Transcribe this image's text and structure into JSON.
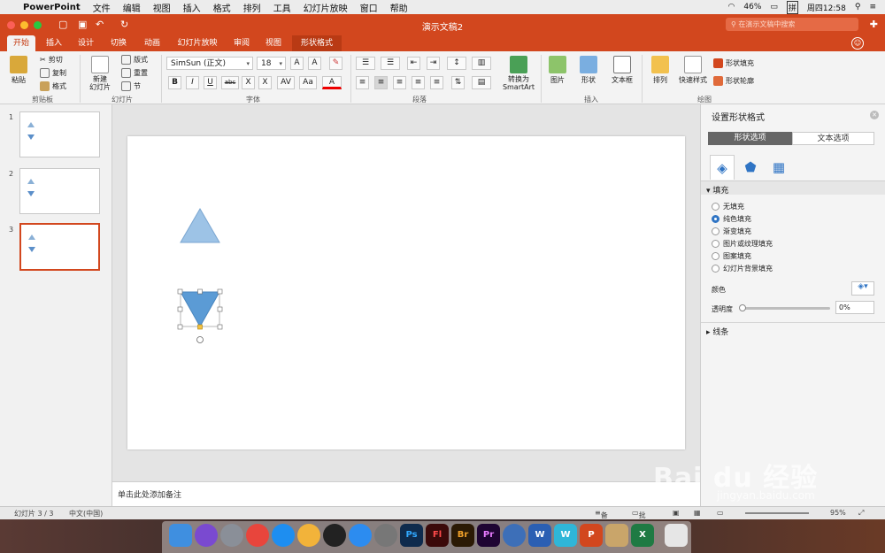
{
  "menubar": {
    "app": "PowerPoint",
    "items": [
      "文件",
      "编辑",
      "视图",
      "插入",
      "格式",
      "排列",
      "工具",
      "幻灯片放映",
      "窗口",
      "帮助"
    ],
    "battery": "46%",
    "ime": "拼",
    "clock": "周四12:58"
  },
  "window": {
    "title": "演示文稿2",
    "search_placeholder": "在演示文稿中搜索"
  },
  "tabs": [
    "开始",
    "插入",
    "设计",
    "切换",
    "动画",
    "幻灯片放映",
    "审阅",
    "视图",
    "形状格式"
  ],
  "ribbon": {
    "paste": "粘贴",
    "cut": "剪切",
    "copy": "复制",
    "format": "格式",
    "clipboard": "剪贴板",
    "new_slide": "新建\n幻灯片",
    "layout": "版式",
    "reset": "重置",
    "section": "节",
    "slides": "幻灯片",
    "font_name": "SimSun (正文)",
    "font_size": "18",
    "font": "字体",
    "paragraph": "段落",
    "convert": "转换为\nSmartArt",
    "picture": "图片",
    "shape": "形状",
    "textbox": "文本框",
    "insert": "插入",
    "arrange": "排列",
    "quick_style": "快速样式",
    "shape_fill": "形状填充",
    "shape_outline": "形状轮廓",
    "drawing": "绘图"
  },
  "slides": [
    {
      "num": "1"
    },
    {
      "num": "2"
    },
    {
      "num": "3"
    }
  ],
  "notes": "单击此处添加备注",
  "format_pane": {
    "title": "设置形状格式",
    "tab_shape": "形状选项",
    "tab_text": "文本选项",
    "fill_section": "填充",
    "fill_options": [
      "无填充",
      "纯色填充",
      "渐变填充",
      "图片或纹理填充",
      "图案填充",
      "幻灯片背景填充"
    ],
    "selected_fill": "纯色填充",
    "color_label": "颜色",
    "transparency_label": "透明度",
    "transparency": "0%",
    "line_section": "线条"
  },
  "status": {
    "slide": "幻灯片 3 / 3",
    "lang": "中文(中国)",
    "notes_btn": "备注",
    "comments_btn": "批注",
    "zoom": "95%"
  },
  "colors": {
    "accent": "#d2471e",
    "triangle_light": "#9dc3e6",
    "triangle_dark": "#5b9bd5"
  },
  "watermark": {
    "brand": "Bai du 经验",
    "url": "jingyan.baidu.com"
  }
}
